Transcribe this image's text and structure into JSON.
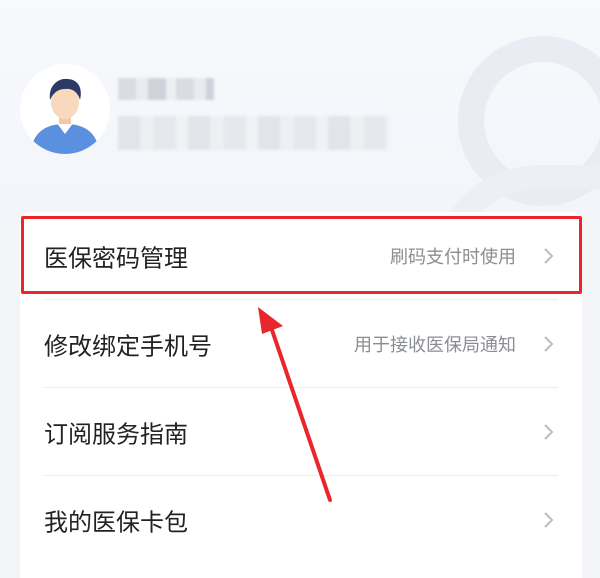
{
  "menu": {
    "items": [
      {
        "label": "医保密码管理",
        "hint": "刷码支付时使用"
      },
      {
        "label": "修改绑定手机号",
        "hint": "用于接收医保局通知"
      },
      {
        "label": "订阅服务指南",
        "hint": ""
      },
      {
        "label": "我的医保卡包",
        "hint": ""
      }
    ]
  },
  "icons": {
    "avatar": "user-avatar-icon",
    "chevron": "chevron-right-icon"
  },
  "colors": {
    "highlight": "#e8262c",
    "label": "#222222",
    "hint": "#8a8d93"
  }
}
